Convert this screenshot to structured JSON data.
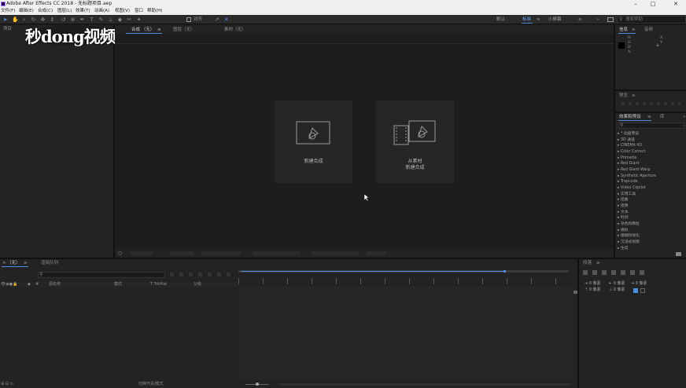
{
  "titlebar": {
    "title": "Adobe After Effects CC 2018 - 无标题项目.aep",
    "minimize": "–",
    "maximize": "□",
    "close": "✕"
  },
  "menu": [
    "文件(F)",
    "编辑(E)",
    "合成(C)",
    "图层(L)",
    "效果(T)",
    "动画(A)",
    "视图(V)",
    "窗口",
    "帮助(H)"
  ],
  "toolbar": {
    "align_label": "对齐",
    "workspace": [
      "默认",
      "标准",
      "小屏幕"
    ],
    "search_placeholder": "搜索帮助"
  },
  "watermark": {
    "text": "秒dong视频"
  },
  "project_panel": {
    "tab": "项目"
  },
  "viewer_tabs": [
    {
      "label": "合成 （无）"
    },
    {
      "label": "图层（无）"
    },
    {
      "label": "素材（无）"
    }
  ],
  "start_cards": [
    {
      "label": "新建合成"
    },
    {
      "label_line1": "从素材",
      "label_line2": "新建合成"
    }
  ],
  "info_panel": {
    "tab_info": "信息",
    "tab_audio": "音频",
    "rgb": [
      "R:",
      "G:",
      "B:",
      "A:"
    ],
    "xy": [
      "X:",
      "Y:"
    ]
  },
  "preview_panel": {
    "tab": "预览"
  },
  "effects_panel": {
    "tab": "效果和预设",
    "tab2": "库",
    "items": [
      "* 动画预设",
      "3D 通道",
      "CINEMA 4D",
      "Color Correct",
      "Primatte",
      "Red Giant",
      "Red Giant Warp",
      "Synthetic Aperture",
      "Trapcode",
      "Video Copilot",
      "实用工具",
      "扭曲",
      "抠像",
      "文本",
      "时间",
      "杂色和颗粒",
      "模拟",
      "模糊和锐化",
      "沉浸式视频",
      "生成"
    ]
  },
  "timeline": {
    "tab_none": "（无）",
    "tab_render": "渲染队列",
    "col_source": "源名称",
    "col_mode": "模式",
    "col_trkmat": "T TrkMat",
    "col_parent": "父级",
    "footer_toggle": "切换开关/模式"
  },
  "align_panel": {
    "tab": "段落",
    "values": [
      "0 像素",
      "0 像素",
      "0 像素",
      "0 像素",
      "0 像素"
    ]
  }
}
